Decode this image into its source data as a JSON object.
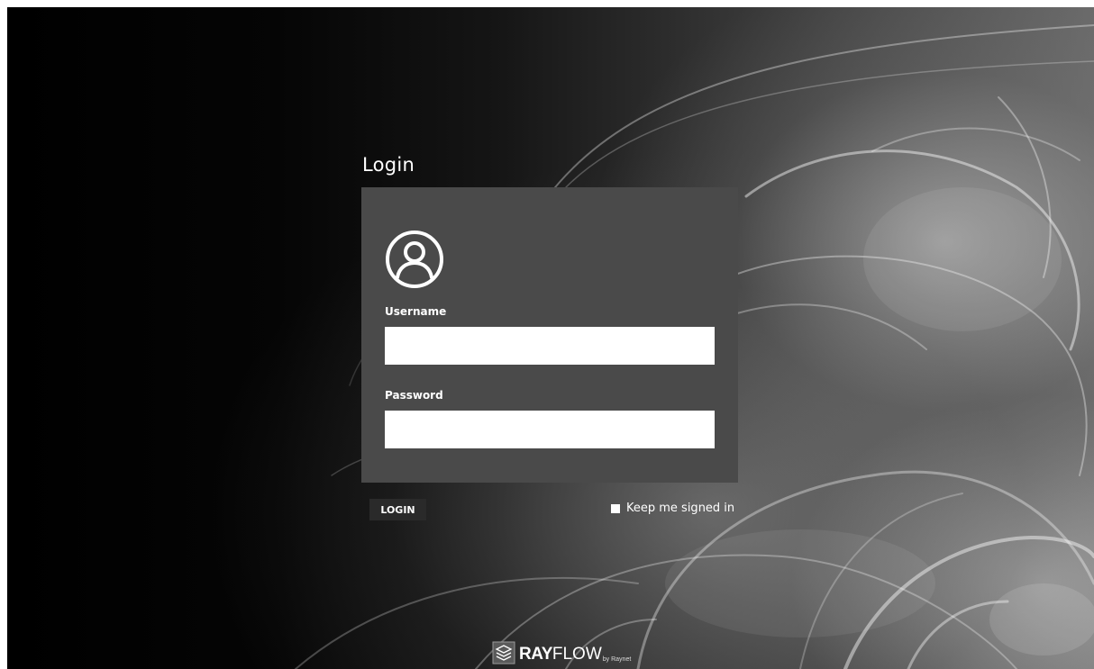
{
  "login": {
    "title": "Login",
    "username_label": "Username",
    "username_value": "",
    "password_label": "Password",
    "password_value": "",
    "login_button": "LOGIN",
    "keep_signed_in_label": "Keep me signed in",
    "keep_signed_in_checked": false
  },
  "icons": {
    "user": "user-circle-icon",
    "brand": "rayflow-logo-icon"
  },
  "brand": {
    "ray": "RAY",
    "flow": "FLOW",
    "by": "by Raynet"
  },
  "colors": {
    "panel": "#4a4a4a",
    "button": "#2a2a2a",
    "text": "#ffffff"
  }
}
